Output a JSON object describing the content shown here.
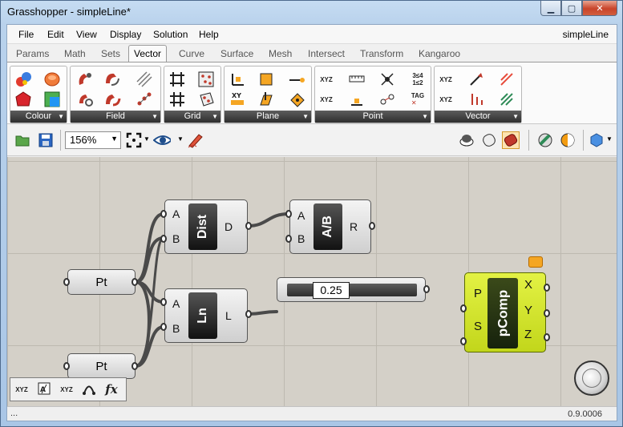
{
  "window": {
    "title": "Grasshopper - simpleLine*"
  },
  "menu": {
    "items": [
      "File",
      "Edit",
      "View",
      "Display",
      "Solution",
      "Help"
    ],
    "doc_name": "simpleLine"
  },
  "tabs": [
    {
      "label": "Params"
    },
    {
      "label": "Math"
    },
    {
      "label": "Sets"
    },
    {
      "label": "Vector",
      "active": true
    },
    {
      "label": "Curve"
    },
    {
      "label": "Surface"
    },
    {
      "label": "Mesh"
    },
    {
      "label": "Intersect"
    },
    {
      "label": "Transform"
    },
    {
      "label": "Kangaroo"
    }
  ],
  "ribbon": {
    "groups": [
      "Colour",
      "Field",
      "Grid",
      "Plane",
      "Point",
      "Vector"
    ]
  },
  "toolbar": {
    "zoom": "156%"
  },
  "canvas": {
    "dist": {
      "in_a": "A",
      "in_b": "B",
      "name": "Dist",
      "out": "D"
    },
    "div": {
      "in_a": "A",
      "in_b": "B",
      "name": "A/B",
      "out": "R"
    },
    "ln": {
      "in_a": "A",
      "in_b": "B",
      "name": "Ln",
      "out": "L"
    },
    "pt1": {
      "label": "Pt"
    },
    "pt2": {
      "label": "Pt"
    },
    "slider": {
      "value": "0.25"
    },
    "pcomp": {
      "in_p": "P",
      "in_s": "S",
      "name": "pComp",
      "out_x": "X",
      "out_y": "Y",
      "out_z": "Z"
    }
  },
  "minibar": {
    "items": [
      "XYZ",
      "fx"
    ]
  },
  "status": {
    "left": "...",
    "version": "0.9.0006"
  },
  "colors": {
    "canvas": "#d4d0c8",
    "pcomp": "#d2e22c",
    "wire": "#4a4a4a"
  }
}
